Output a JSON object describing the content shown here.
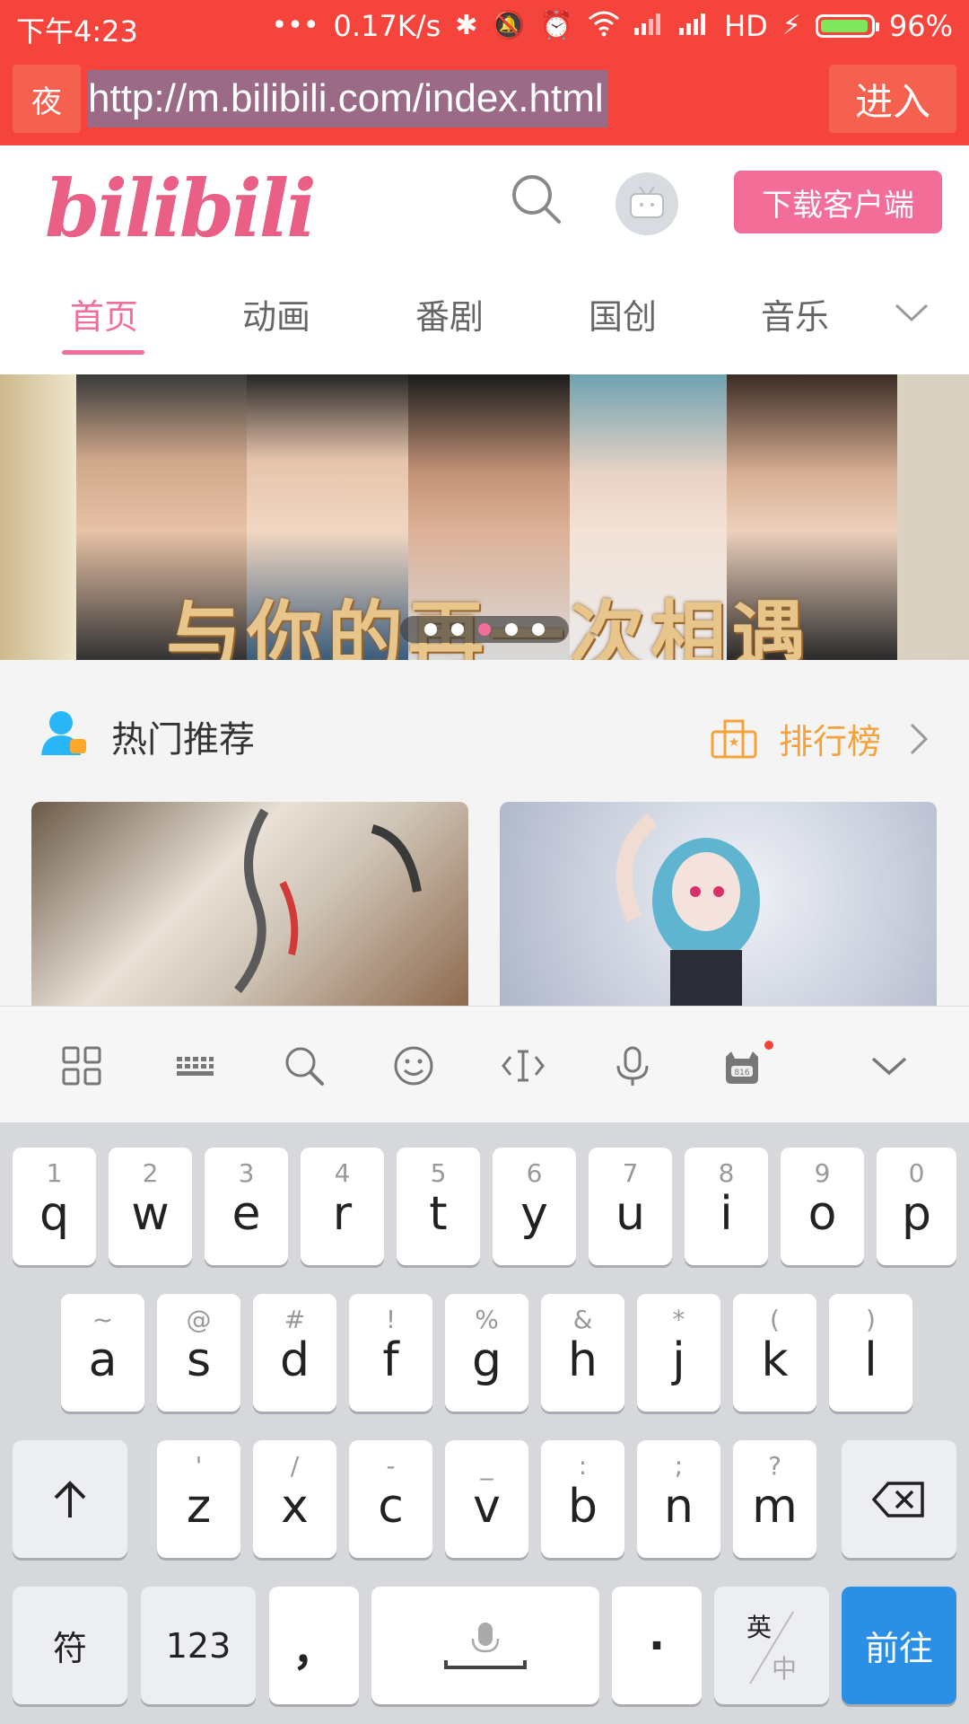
{
  "status_bar": {
    "time": "下午4:23",
    "net_speed": "0.17K/s",
    "hd_label": "HD",
    "battery": "96%",
    "battery_level": 0.96,
    "dots": "•••"
  },
  "url_bar": {
    "night_label": "夜",
    "url": "http://m.bilibili.com/index.html",
    "enter_label": "进入"
  },
  "header": {
    "logo_text": "bilibili",
    "download_label": "下载客户端",
    "tabs": [
      {
        "label": "首页",
        "active": true
      },
      {
        "label": "动画",
        "active": false
      },
      {
        "label": "番剧",
        "active": false
      },
      {
        "label": "国创",
        "active": false
      },
      {
        "label": "音乐",
        "active": false
      }
    ]
  },
  "banner": {
    "title": "与你的再一次相遇",
    "dot_count": 5,
    "active_dot": 2
  },
  "section": {
    "title": "热门推荐",
    "rank_label": "排行榜"
  },
  "keyboard": {
    "row1": [
      {
        "main": "q",
        "sub": "1"
      },
      {
        "main": "w",
        "sub": "2"
      },
      {
        "main": "e",
        "sub": "3"
      },
      {
        "main": "r",
        "sub": "4"
      },
      {
        "main": "t",
        "sub": "5"
      },
      {
        "main": "y",
        "sub": "6"
      },
      {
        "main": "u",
        "sub": "7"
      },
      {
        "main": "i",
        "sub": "8"
      },
      {
        "main": "o",
        "sub": "9"
      },
      {
        "main": "p",
        "sub": "0"
      }
    ],
    "row2": [
      {
        "main": "a",
        "sub": "~"
      },
      {
        "main": "s",
        "sub": "@"
      },
      {
        "main": "d",
        "sub": "#"
      },
      {
        "main": "f",
        "sub": "!"
      },
      {
        "main": "g",
        "sub": "%"
      },
      {
        "main": "h",
        "sub": "&"
      },
      {
        "main": "j",
        "sub": "*"
      },
      {
        "main": "k",
        "sub": "("
      },
      {
        "main": "l",
        "sub": ")"
      }
    ],
    "row3": [
      {
        "main": "z",
        "sub": "'"
      },
      {
        "main": "x",
        "sub": "/"
      },
      {
        "main": "c",
        "sub": "-"
      },
      {
        "main": "v",
        "sub": "_"
      },
      {
        "main": "b",
        "sub": ":"
      },
      {
        "main": "n",
        "sub": ";"
      },
      {
        "main": "m",
        "sub": "?"
      }
    ],
    "symbol_label": "符",
    "num_label": "123",
    "comma_label": "，",
    "period_label": "·",
    "lang_top": "英",
    "lang_bottom": "中",
    "go_label": "前往"
  },
  "colors": {
    "status_red": "#f5443b",
    "bili_pink": "#f26e98",
    "rank_orange": "#f6a23b",
    "go_blue": "#2b8fe6"
  }
}
